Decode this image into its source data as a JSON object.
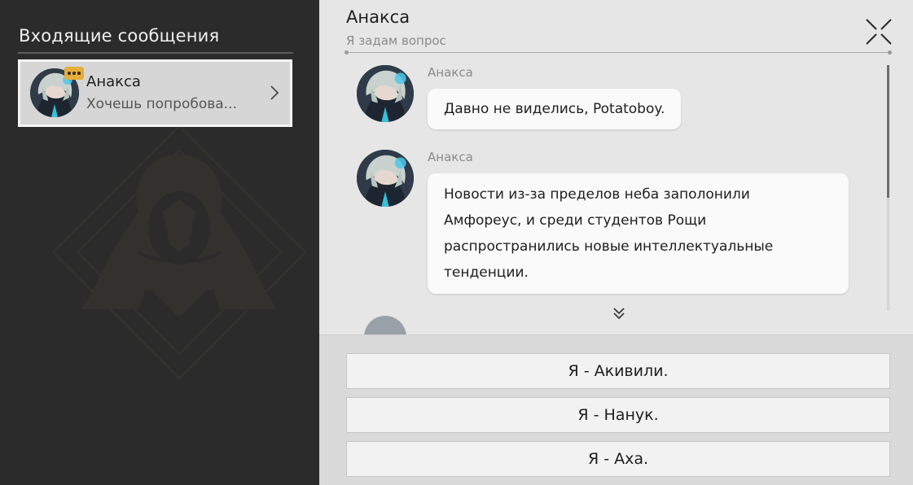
{
  "inbox": {
    "title": "Входящие сообщения",
    "contacts": [
      {
        "name": "Анакса",
        "preview": "Хочешь попробова...",
        "avatar": "anaxa-avatar",
        "badge": "typing-dots-icon",
        "selected": true
      }
    ]
  },
  "chat": {
    "title": "Анакса",
    "subtitle": "Я задам вопрос",
    "messages": [
      {
        "sender": "Анакса",
        "avatar": "anaxa-avatar",
        "lines": [
          "Давно не виделись, Potatoboy."
        ]
      },
      {
        "sender": "Анакса",
        "avatar": "anaxa-avatar",
        "lines": [
          "Новости из-за пределов неба заполонили",
          "Амфореус, и среди студентов Рощи",
          "распространились новые интеллектуальные",
          "тенденции."
        ]
      }
    ],
    "close_icon": "close-icon",
    "more_icon": "double-chevron-down-icon"
  },
  "options": [
    {
      "label": "Я - Акивили."
    },
    {
      "label": "Я - Нанук."
    },
    {
      "label": "Я - Аха."
    }
  ],
  "colors": {
    "left_bg": "#2b2b2b",
    "right_bg": "#e6e6e6",
    "card_bg": "#d6d6d6",
    "badge": "#e3ae3c",
    "bubble": "#fafafa"
  }
}
